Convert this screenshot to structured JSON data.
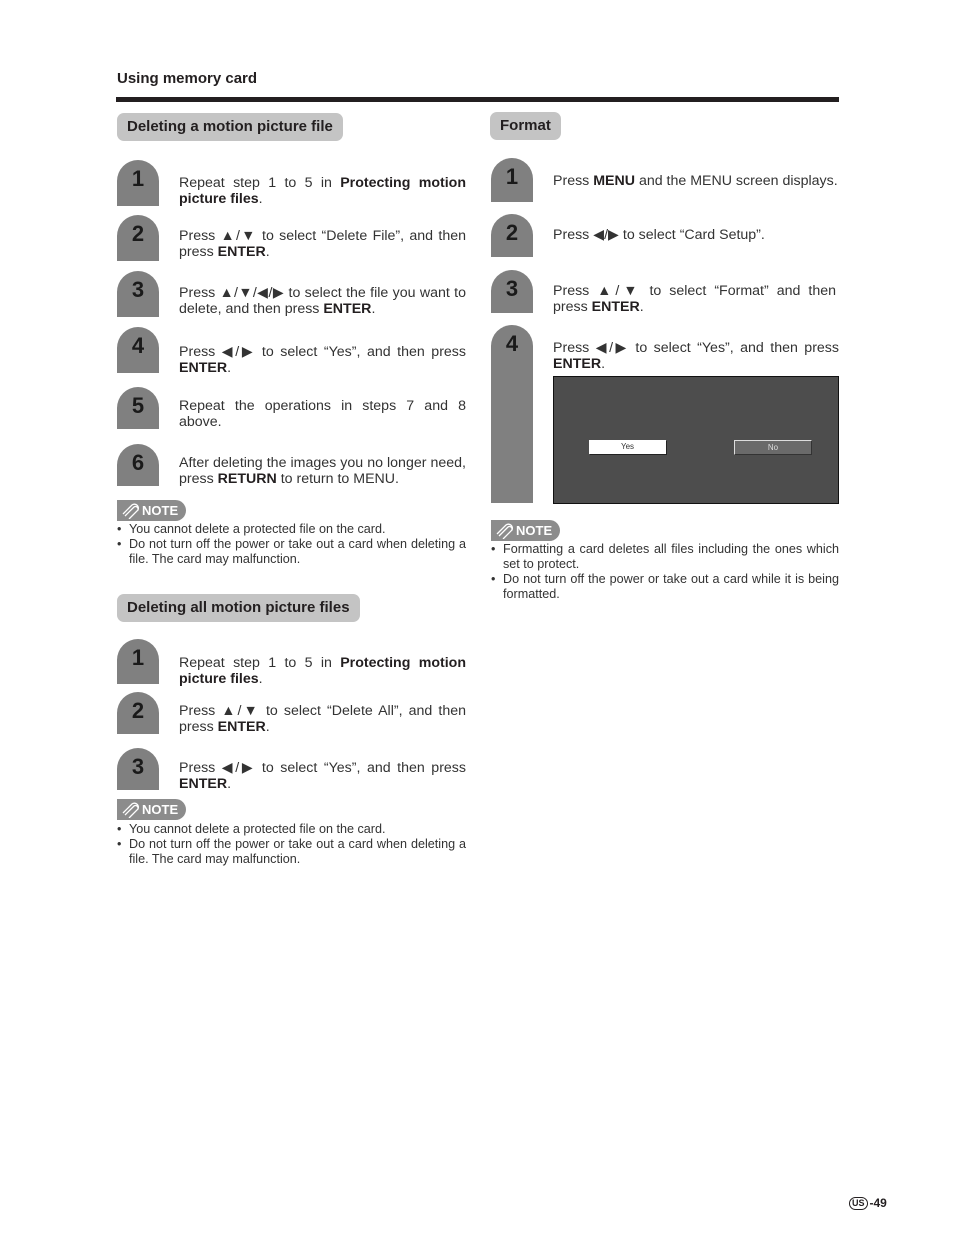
{
  "header": {
    "title": "Using memory card"
  },
  "sections": {
    "delete_file": {
      "title": "Deleting a motion picture file",
      "steps": [
        {
          "num": "1",
          "pre": "Repeat step 1 to 5 in ",
          "bold": "Protecting motion picture files",
          "post": "."
        },
        {
          "num": "2",
          "pre": "Press ▲/▼ to select “Delete File”, and then press ",
          "bold": "ENTER",
          "post": "."
        },
        {
          "num": "3",
          "pre": "Press ▲/▼/◀/▶ to select the file you want to delete, and then press ",
          "bold": "ENTER",
          "post": "."
        },
        {
          "num": "4",
          "pre": "Press ◀/▶ to select “Yes”, and then press ",
          "bold": "ENTER",
          "post": "."
        },
        {
          "num": "5",
          "pre": "Repeat the operations in steps 7 and 8 above.",
          "bold": "",
          "post": ""
        },
        {
          "num": "6",
          "pre": "After deleting the images you no longer need, press ",
          "bold": "RETURN",
          "post": " to return to MENU."
        }
      ],
      "note_label": "NOTE",
      "notes": [
        "You cannot delete a protected file on the card.",
        "Do not turn off the power or take out a card when deleting a file. The card may malfunction."
      ]
    },
    "delete_all": {
      "title": "Deleting all motion picture files",
      "steps": [
        {
          "num": "1",
          "pre": "Repeat step 1 to 5 in ",
          "bold": "Protecting motion picture files",
          "post": "."
        },
        {
          "num": "2",
          "pre": "Press ▲/▼ to select “Delete All”, and then press ",
          "bold": "ENTER",
          "post": "."
        },
        {
          "num": "3",
          "pre": "Press ◀/▶ to select “Yes”, and then press ",
          "bold": "ENTER",
          "post": "."
        }
      ],
      "note_label": "NOTE",
      "notes": [
        "You cannot delete a protected file on the card.",
        "Do not turn off the power or take out a card when deleting a file. The card may malfunction."
      ]
    },
    "format": {
      "title": "Format",
      "steps": [
        {
          "num": "1",
          "pre": "Press ",
          "bold": "MENU",
          "post": " and the MENU screen displays."
        },
        {
          "num": "2",
          "pre": "Press ◀/▶ to select “Card Setup”.",
          "bold": "",
          "post": ""
        },
        {
          "num": "3",
          "pre": "Press ▲/▼ to select “Format” and then press ",
          "bold": "ENTER",
          "post": "."
        },
        {
          "num": "4",
          "pre": "Press ◀/▶ to select “Yes”, and then press ",
          "bold": "ENTER",
          "post": "."
        }
      ],
      "screen": {
        "yes_label": "Yes",
        "no_label": "No",
        "selected": "Yes"
      },
      "note_label": "NOTE",
      "notes": [
        "Formatting a card deletes all files including the ones which set to protect.",
        "Do not turn off the power or take out a card while it is being formatted."
      ]
    }
  },
  "footer": {
    "region": "US",
    "page": "-49"
  },
  "colors": {
    "badge_gray": "#808080",
    "title_bg": "#c4c4c4",
    "screen_bg": "#4d4d4d",
    "rule": "#231f20"
  }
}
